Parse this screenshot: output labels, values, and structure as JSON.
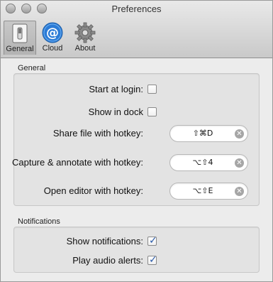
{
  "window": {
    "title": "Preferences"
  },
  "toolbar": {
    "items": [
      {
        "label": "General",
        "icon": "switch-icon",
        "active": true
      },
      {
        "label": "Cloud",
        "icon": "at-sign-icon",
        "active": false
      },
      {
        "label": "About",
        "icon": "gear-icon",
        "active": false
      }
    ]
  },
  "general": {
    "title": "General",
    "start_at_login": {
      "label": "Start at login:",
      "checked": false
    },
    "show_in_dock": {
      "label": "Show in dock",
      "checked": false
    },
    "share_file_hotkey": {
      "label": "Share file with hotkey:",
      "value": "⇧⌘D"
    },
    "capture_hotkey": {
      "label": "Capture & annotate with hotkey:",
      "value": "⌥⇧4"
    },
    "editor_hotkey": {
      "label": "Open editor with hotkey:",
      "value": "⌥⇧E"
    }
  },
  "notifications": {
    "title": "Notifications",
    "show_notifications": {
      "label": "Show notifications:",
      "checked": true
    },
    "play_audio_alerts": {
      "label": "Play audio alerts:",
      "checked": true
    }
  },
  "colors": {
    "accent": "#2a5aa8",
    "cloud_icon": "#2b7bd6"
  }
}
